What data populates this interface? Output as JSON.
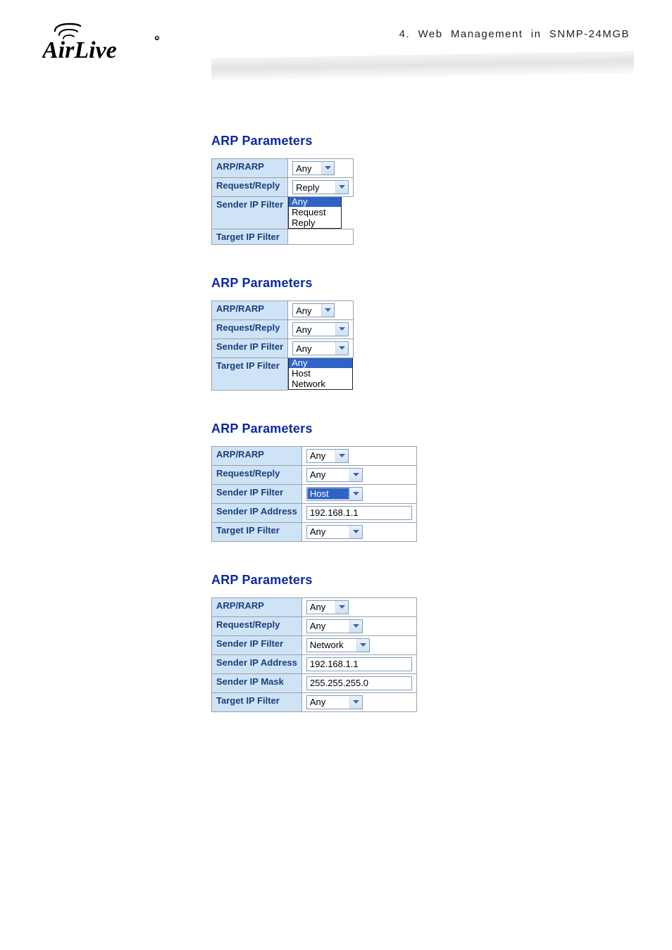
{
  "header": {
    "chapter_line": "4.  Web  Management  in  SNMP-24MGB",
    "logo_text": "AirLive"
  },
  "sections": [
    {
      "title": "ARP Parameters",
      "rows": [
        {
          "label": "ARP/RARP",
          "ctrl": "select",
          "value": "Any",
          "width": "w50"
        },
        {
          "label": "Request/Reply",
          "ctrl": "select",
          "value": "Reply",
          "width": "w70"
        },
        {
          "label": "Sender IP Filter",
          "ctrl": "openlist",
          "selected": "Any",
          "options": [
            "Any",
            "Request",
            "Reply"
          ]
        },
        {
          "label": "Target IP Filter"
        }
      ]
    },
    {
      "title": "ARP Parameters",
      "rows": [
        {
          "label": "ARP/RARP",
          "ctrl": "select",
          "value": "Any",
          "width": "w50"
        },
        {
          "label": "Request/Reply",
          "ctrl": "select",
          "value": "Any",
          "width": "w70"
        },
        {
          "label": "Sender IP Filter",
          "ctrl": "select",
          "value": "Any",
          "width": "w70"
        },
        {
          "label": "Target IP Filter",
          "ctrl": "openlist",
          "selected": "Any",
          "options": [
            "Any",
            "Host",
            "Network"
          ],
          "boxw": "90px"
        }
      ]
    },
    {
      "title": "ARP Parameters",
      "rows": [
        {
          "label": "ARP/RARP",
          "ctrl": "select",
          "value": "Any",
          "width": "w50"
        },
        {
          "label": "Request/Reply",
          "ctrl": "select",
          "value": "Any",
          "width": "w70"
        },
        {
          "label": "Sender IP Filter",
          "ctrl": "select-hl",
          "value": "Host",
          "width": "w70"
        },
        {
          "label": "Sender IP Address",
          "ctrl": "input",
          "value": "192.168.1.1",
          "width": "w130"
        },
        {
          "label": "Target IP Filter",
          "ctrl": "select",
          "value": "Any",
          "width": "w70"
        }
      ]
    },
    {
      "title": "ARP Parameters",
      "rows": [
        {
          "label": "ARP/RARP",
          "ctrl": "select",
          "value": "Any",
          "width": "w50"
        },
        {
          "label": "Request/Reply",
          "ctrl": "select",
          "value": "Any",
          "width": "w70"
        },
        {
          "label": "Sender IP Filter",
          "ctrl": "select",
          "value": "Network",
          "width": "w86"
        },
        {
          "label": "Sender IP Address",
          "ctrl": "input",
          "value": "192.168.1.1",
          "width": "w130"
        },
        {
          "label": "Sender IP Mask",
          "ctrl": "input",
          "value": "255.255.255.0",
          "width": "w130"
        },
        {
          "label": "Target IP Filter",
          "ctrl": "select",
          "value": "Any",
          "width": "w70"
        }
      ]
    }
  ]
}
